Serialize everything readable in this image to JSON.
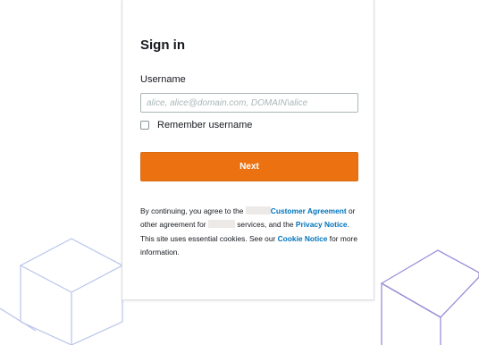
{
  "signin": {
    "title": "Sign in",
    "username_label": "Username",
    "username_value": "",
    "username_placeholder": "alice, alice@domain.com, DOMAIN\\alice",
    "remember_label": "Remember username",
    "remember_checked": false,
    "next_label": "Next"
  },
  "legal": {
    "part1": "By continuing, you agree to the ",
    "customer_agreement_link": "Customer Agreement",
    "part2": " or other agreement for ",
    "part3": " services, and the ",
    "privacy_link": "Privacy Notice",
    "part4": ". This site uses essential cookies. See our ",
    "cookie_link": "Cookie Notice",
    "part5": " for more information."
  },
  "colors": {
    "accent": "#ec7211",
    "link": "#0073bb",
    "decoration": "#b8c4ea"
  },
  "icons": {
    "left_decoration": "isometric-cube-outline-icon",
    "right_decoration": "isometric-cube-outline-icon"
  }
}
